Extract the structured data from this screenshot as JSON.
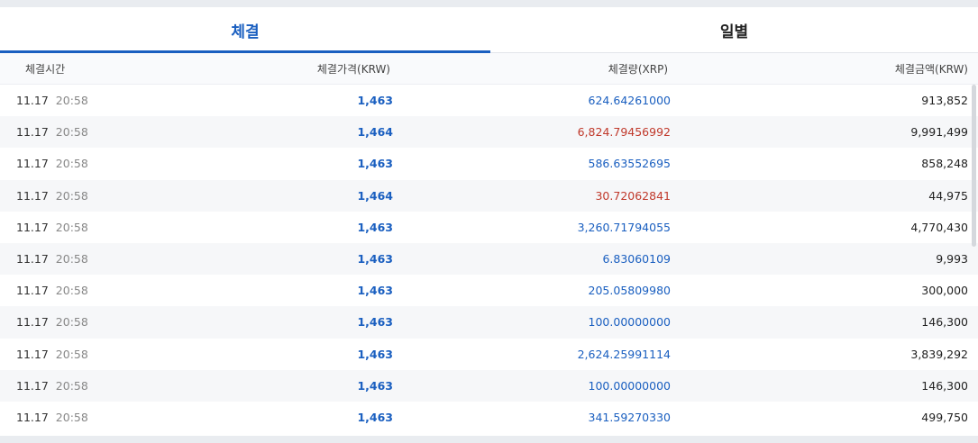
{
  "tabs": [
    {
      "label": "체결",
      "active": true
    },
    {
      "label": "일별",
      "active": false
    }
  ],
  "headers": {
    "time": "체결시간",
    "price": "체결가격(KRW)",
    "qty": "체결량(XRP)",
    "amount": "체결금액(KRW)"
  },
  "colors": {
    "accent": "#1a5fc0",
    "sell": "#c0392b"
  },
  "rows": [
    {
      "date": "11.17",
      "time": "20:58",
      "price": "1,463",
      "qty": "624.64261000",
      "qty_side": "blue",
      "amount": "913,852"
    },
    {
      "date": "11.17",
      "time": "20:58",
      "price": "1,464",
      "qty": "6,824.79456992",
      "qty_side": "red",
      "amount": "9,991,499"
    },
    {
      "date": "11.17",
      "time": "20:58",
      "price": "1,463",
      "qty": "586.63552695",
      "qty_side": "blue",
      "amount": "858,248"
    },
    {
      "date": "11.17",
      "time": "20:58",
      "price": "1,464",
      "qty": "30.72062841",
      "qty_side": "red",
      "amount": "44,975"
    },
    {
      "date": "11.17",
      "time": "20:58",
      "price": "1,463",
      "qty": "3,260.71794055",
      "qty_side": "blue",
      "amount": "4,770,430"
    },
    {
      "date": "11.17",
      "time": "20:58",
      "price": "1,463",
      "qty": "6.83060109",
      "qty_side": "blue",
      "amount": "9,993"
    },
    {
      "date": "11.17",
      "time": "20:58",
      "price": "1,463",
      "qty": "205.05809980",
      "qty_side": "blue",
      "amount": "300,000"
    },
    {
      "date": "11.17",
      "time": "20:58",
      "price": "1,463",
      "qty": "100.00000000",
      "qty_side": "blue",
      "amount": "146,300"
    },
    {
      "date": "11.17",
      "time": "20:58",
      "price": "1,463",
      "qty": "2,624.25991114",
      "qty_side": "blue",
      "amount": "3,839,292"
    },
    {
      "date": "11.17",
      "time": "20:58",
      "price": "1,463",
      "qty": "100.00000000",
      "qty_side": "blue",
      "amount": "146,300"
    },
    {
      "date": "11.17",
      "time": "20:58",
      "price": "1,463",
      "qty": "341.59270330",
      "qty_side": "blue",
      "amount": "499,750"
    }
  ]
}
